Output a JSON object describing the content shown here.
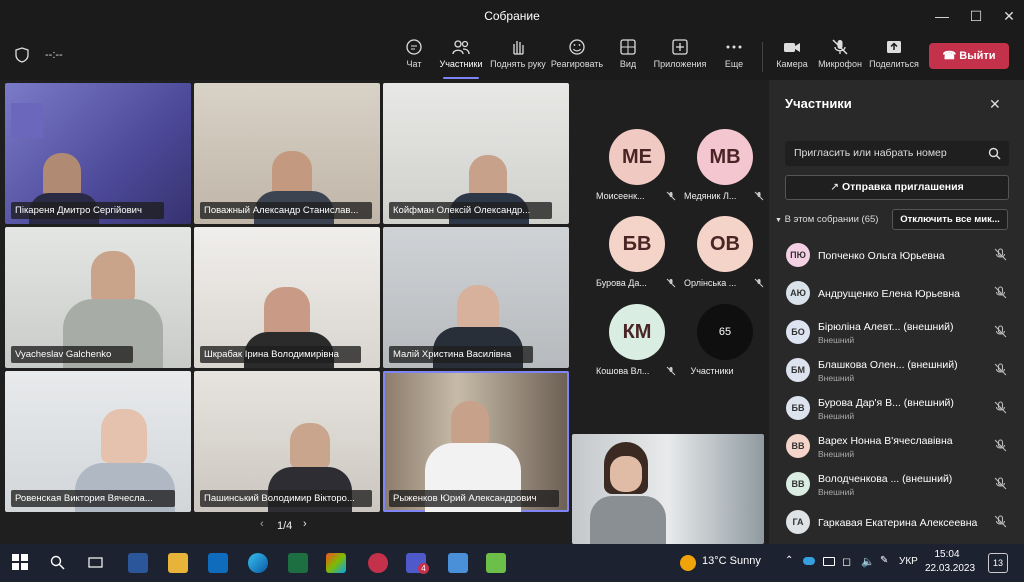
{
  "window": {
    "title": "Собрание"
  },
  "toolbar": {
    "timer": "--:--",
    "buttons": [
      {
        "label": "Чат",
        "icon": "chat-icon"
      },
      {
        "label": "Участники",
        "icon": "people-icon"
      },
      {
        "label": "Поднять руку",
        "icon": "raise-hand-icon"
      },
      {
        "label": "Реагировать",
        "icon": "smile-icon"
      },
      {
        "label": "Вид",
        "icon": "grid-view-icon"
      },
      {
        "label": "Приложения",
        "icon": "apps-plus-icon"
      },
      {
        "label": "Еще",
        "icon": "more-icon"
      },
      {
        "label": "Камера",
        "icon": "camera-icon"
      },
      {
        "label": "Микрофон",
        "icon": "mic-off-icon"
      },
      {
        "label": "Поделиться",
        "icon": "share-icon"
      }
    ],
    "leave_label": "Выйти"
  },
  "tiles": [
    {
      "name": "Пікареня Дмитро Сергійович"
    },
    {
      "name": "Поважный Александр Станислав..."
    },
    {
      "name": "Койфман Олексій Олександр..."
    },
    {
      "name": "Vyacheslav Galchenko"
    },
    {
      "name": "Шкрабак Ірина Володимирівна"
    },
    {
      "name": "Малій Христина Василівна"
    },
    {
      "name": "Ровенская Виктория Вячесла..."
    },
    {
      "name": "Пашинський Володимир Вікторо..."
    },
    {
      "name": "Рыженков Юрий Александрович"
    }
  ],
  "avatar_grid": [
    {
      "initials": "МЕ",
      "name": "Моисеенк...",
      "color": "#f0c9c3"
    },
    {
      "initials": "МВ",
      "name": "Медяник Л...",
      "color": "#f4c6cf"
    },
    {
      "initials": "БВ",
      "name": "Бурова Да...",
      "color": "#f4d3c9"
    },
    {
      "initials": "ОВ",
      "name": "Орлінська ...",
      "color": "#f4d3c9"
    },
    {
      "initials": "КМ",
      "name": "Кошова Вл...",
      "color": "#d9ede2"
    }
  ],
  "overflow": {
    "count": "65",
    "label": "Участники"
  },
  "pager": {
    "text": "1/4"
  },
  "panel": {
    "title": "Участники",
    "invite_placeholder": "Пригласить или набрать номер",
    "send_invite": "Отправка приглашения",
    "in_meeting": "В этом собрании (65)",
    "mute_all": "Отключить все мик...",
    "participants": [
      {
        "initials": "ПЮ",
        "name": "Попченко Ольга Юрьевна",
        "sub": "",
        "color": "#f3d0e3"
      },
      {
        "initials": "АЮ",
        "name": "Андрущенко Елена Юрьевна",
        "sub": "",
        "color": "#d9e2ea"
      },
      {
        "initials": "БО",
        "name": "Бірюліна Алевт...  (внешний)",
        "sub": "Внешний",
        "color": "#dde3f1"
      },
      {
        "initials": "БМ",
        "name": "Блашкова Олен...  (внешний)",
        "sub": "Внешний",
        "color": "#dce3ee"
      },
      {
        "initials": "БВ",
        "name": "Бурова Дар'я В...  (внешний)",
        "sub": "Внешний",
        "color": "#dce3ee"
      },
      {
        "initials": "ВВ",
        "name": "Варех Нонна В'ячеславівна",
        "sub": "Внешний",
        "color": "#f4d3c9"
      },
      {
        "initials": "ВВ",
        "name": "Володченкова ...  (внешний)",
        "sub": "Внешний",
        "color": "#d9ede2"
      },
      {
        "initials": "ГА",
        "name": "Гаркавая Екатерина Алексеевна",
        "sub": "",
        "color": "#dfe3e6"
      }
    ]
  },
  "taskbar": {
    "weather": "13°C  Sunny",
    "lang": "УКР",
    "time": "15:04",
    "date": "22.03.2023",
    "notif_count": "13",
    "teams_badge": "4"
  }
}
